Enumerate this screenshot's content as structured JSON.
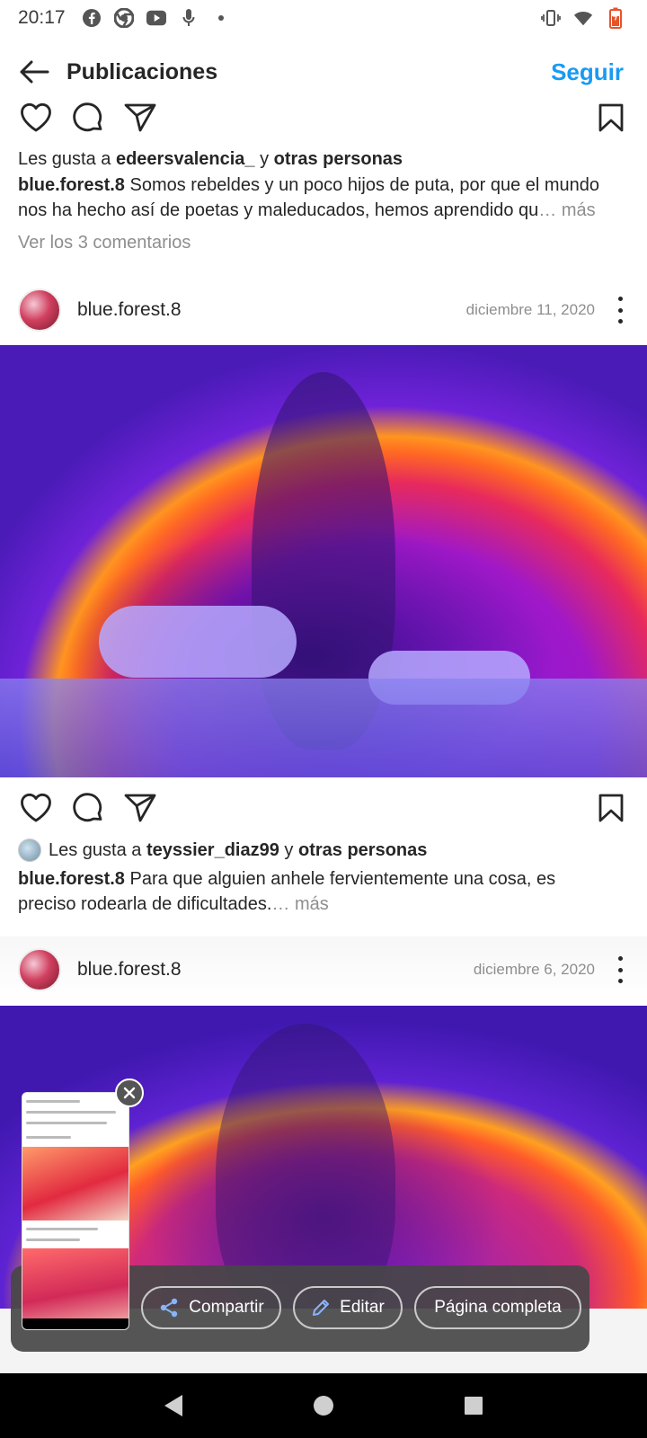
{
  "status_bar": {
    "time": "20:17",
    "left_icons": [
      "facebook-icon",
      "chrome-icon",
      "youtube-icon",
      "mic-icon",
      "dot-icon"
    ],
    "right_icons": [
      "vibrate-icon",
      "wifi-icon",
      "battery-icon"
    ],
    "battery_color": "#e8532a"
  },
  "header": {
    "title": "Publicaciones",
    "follow_label": "Seguir",
    "follow_color": "#1a9af2"
  },
  "post_prev": {
    "likes_prefix": "Les gusta a ",
    "likes_user": "edeersvalencia_",
    "likes_join": " y ",
    "likes_others": "otras personas",
    "caption_user": "blue.forest.8",
    "caption_text": " Somos rebeldes y un poco hijos de puta, por que el mundo nos ha hecho así de poetas y maleducados, hemos aprendido qu",
    "more": "… más",
    "comments_link": "Ver los 3 comentarios"
  },
  "post1": {
    "username": "blue.forest.8",
    "date": "diciembre 11, 2020",
    "likes_prefix": "Les gusta a ",
    "likes_user": "teyssier_diaz99",
    "likes_join": " y ",
    "likes_others": "otras personas",
    "caption_user": "blue.forest.8",
    "caption_text": " Para que alguien anhele fervientemente una cosa, es preciso rodearla de dificultades.",
    "more": "… más"
  },
  "post2": {
    "username": "blue.forest.8",
    "date": "diciembre 6, 2020"
  },
  "share_overlay": {
    "share_label": "Compartir",
    "edit_label": "Editar",
    "full_page_label": "Página completa"
  }
}
